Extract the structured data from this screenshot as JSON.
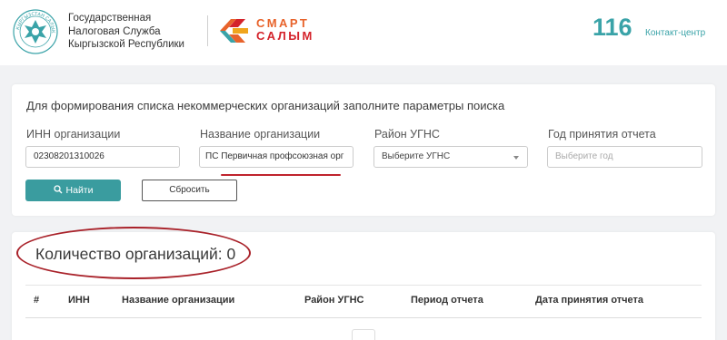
{
  "header": {
    "agency_lines": [
      "Государственная",
      "Налоговая Служба",
      "Кыргызской Республики"
    ],
    "emblem_text": "КЫРГЫЗСТАН САЛЫК КЫЗМАТЫ",
    "smart_line1": "СМАРТ",
    "smart_line2": "САЛЫМ",
    "phone": "116",
    "contact_label": "Контакт-центр"
  },
  "form": {
    "title": "Для формирования списка некоммерческих организаций заполните параметры поиска",
    "inn_label": "ИНН организации",
    "inn_value": "02308201310026",
    "name_label": "Название организации",
    "name_value": "ПС Первичная профсоюзная орг",
    "district_label": "Район УГНС",
    "district_value": "Выберите УГНС",
    "year_label": "Год принятия отчета",
    "year_placeholder": "Выберите год",
    "find_button": "Найти",
    "reset_button": "Сбросить"
  },
  "results": {
    "count_text": "Количество организаций: 0",
    "columns": [
      "#",
      "ИНН",
      "Название организации",
      "Район УГНС",
      "Период отчета",
      "Дата принятия отчета"
    ]
  },
  "colors": {
    "accent": "#3a9c9f",
    "phone": "#3aa3a8",
    "annotation_red": "#a9222a",
    "smart_orange": "#e8632b",
    "smart_red": "#d4232b"
  }
}
